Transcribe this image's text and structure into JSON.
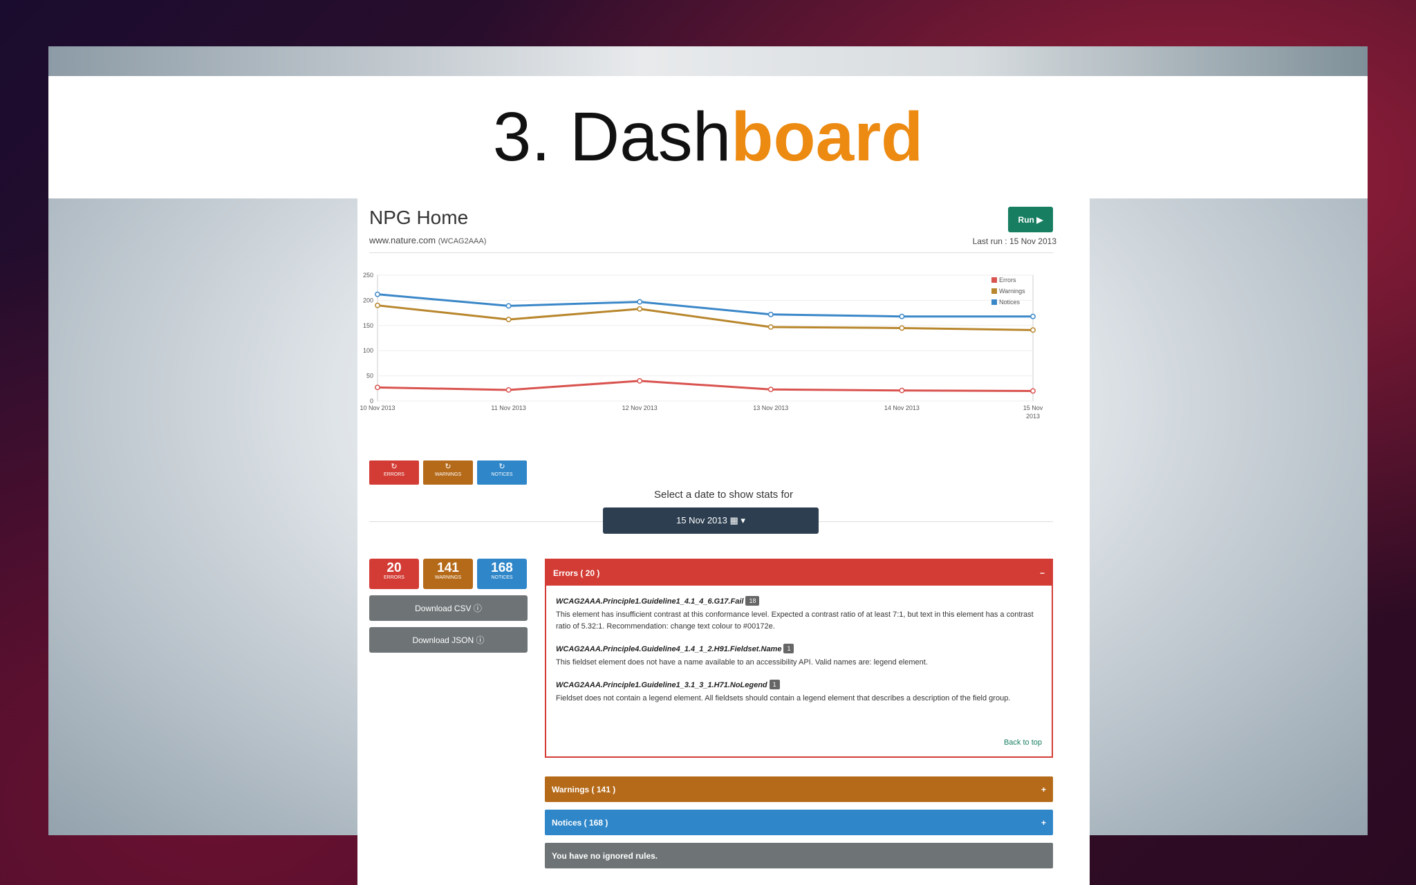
{
  "slide": {
    "title_prefix": "3. Dash",
    "title_accent": "board"
  },
  "header": {
    "title": "NPG Home",
    "url": "www.nature.com",
    "standard": "(WCAG2AAA)",
    "run_label": "Run ▶",
    "last_run": "Last run : 15 Nov 2013"
  },
  "colors": {
    "errors": "#d33c35",
    "warnings": "#b56a19",
    "notices": "#2f86c9",
    "run": "#177e61",
    "dark": "#2c3e50",
    "grey": "#6e7476"
  },
  "chart_data": {
    "type": "line",
    "x": [
      "10 Nov 2013",
      "11 Nov 2013",
      "12 Nov 2013",
      "13 Nov 2013",
      "14 Nov 2013",
      "15 Nov 2013"
    ],
    "ylim": [
      0,
      250
    ],
    "yticks": [
      0,
      50,
      100,
      150,
      200,
      250
    ],
    "series": [
      {
        "name": "Errors",
        "color": "#d9534f",
        "values": [
          27,
          22,
          40,
          23,
          21,
          20
        ]
      },
      {
        "name": "Warnings",
        "color": "#b8862c",
        "values": [
          190,
          162,
          183,
          147,
          145,
          141
        ]
      },
      {
        "name": "Notices",
        "color": "#3a87c8",
        "values": [
          212,
          189,
          197,
          172,
          168,
          168
        ]
      }
    ],
    "legend": "top-right",
    "grid": true
  },
  "toggles": [
    {
      "label": "ERRORS",
      "icon": "↻"
    },
    {
      "label": "WARNINGS",
      "icon": "↻"
    },
    {
      "label": "NOTICES",
      "icon": "↻"
    }
  ],
  "date_select": {
    "label": "Select a date to show stats for",
    "value": "15 Nov 2013 ▦ ▾"
  },
  "stats": [
    {
      "value": "20",
      "label": "ERRORS"
    },
    {
      "value": "141",
      "label": "WARNINGS"
    },
    {
      "value": "168",
      "label": "NOTICES"
    }
  ],
  "downloads": {
    "csv": "Download CSV ⓘ",
    "json": "Download JSON ⓘ"
  },
  "errors_panel": {
    "title": "Errors ( 20 )",
    "toggle": "−",
    "issues": [
      {
        "code": "WCAG2AAA.Principle1.Guideline1_4.1_4_6.G17.Fail",
        "count": "18",
        "desc": "This element has insufficient contrast at this conformance level. Expected a contrast ratio of at least 7:1, but text in this element has a contrast ratio of 5.32:1. Recommendation: change text colour to #00172e."
      },
      {
        "code": "WCAG2AAA.Principle4.Guideline4_1.4_1_2.H91.Fieldset.Name",
        "count": "1",
        "desc": "This fieldset element does not have a name available to an accessibility API. Valid names are: legend element."
      },
      {
        "code": "WCAG2AAA.Principle1.Guideline1_3.1_3_1.H71.NoLegend",
        "count": "1",
        "desc": "Fieldset does not contain a legend element. All fieldsets should contain a legend element that describes a description of the field group."
      }
    ],
    "back_to_top": "Back to top"
  },
  "warnings_panel": {
    "title": "Warnings ( 141 )",
    "toggle": "+"
  },
  "notices_panel": {
    "title": "Notices ( 168 )",
    "toggle": "+"
  },
  "ignored": {
    "text": "You have no ignored rules."
  }
}
